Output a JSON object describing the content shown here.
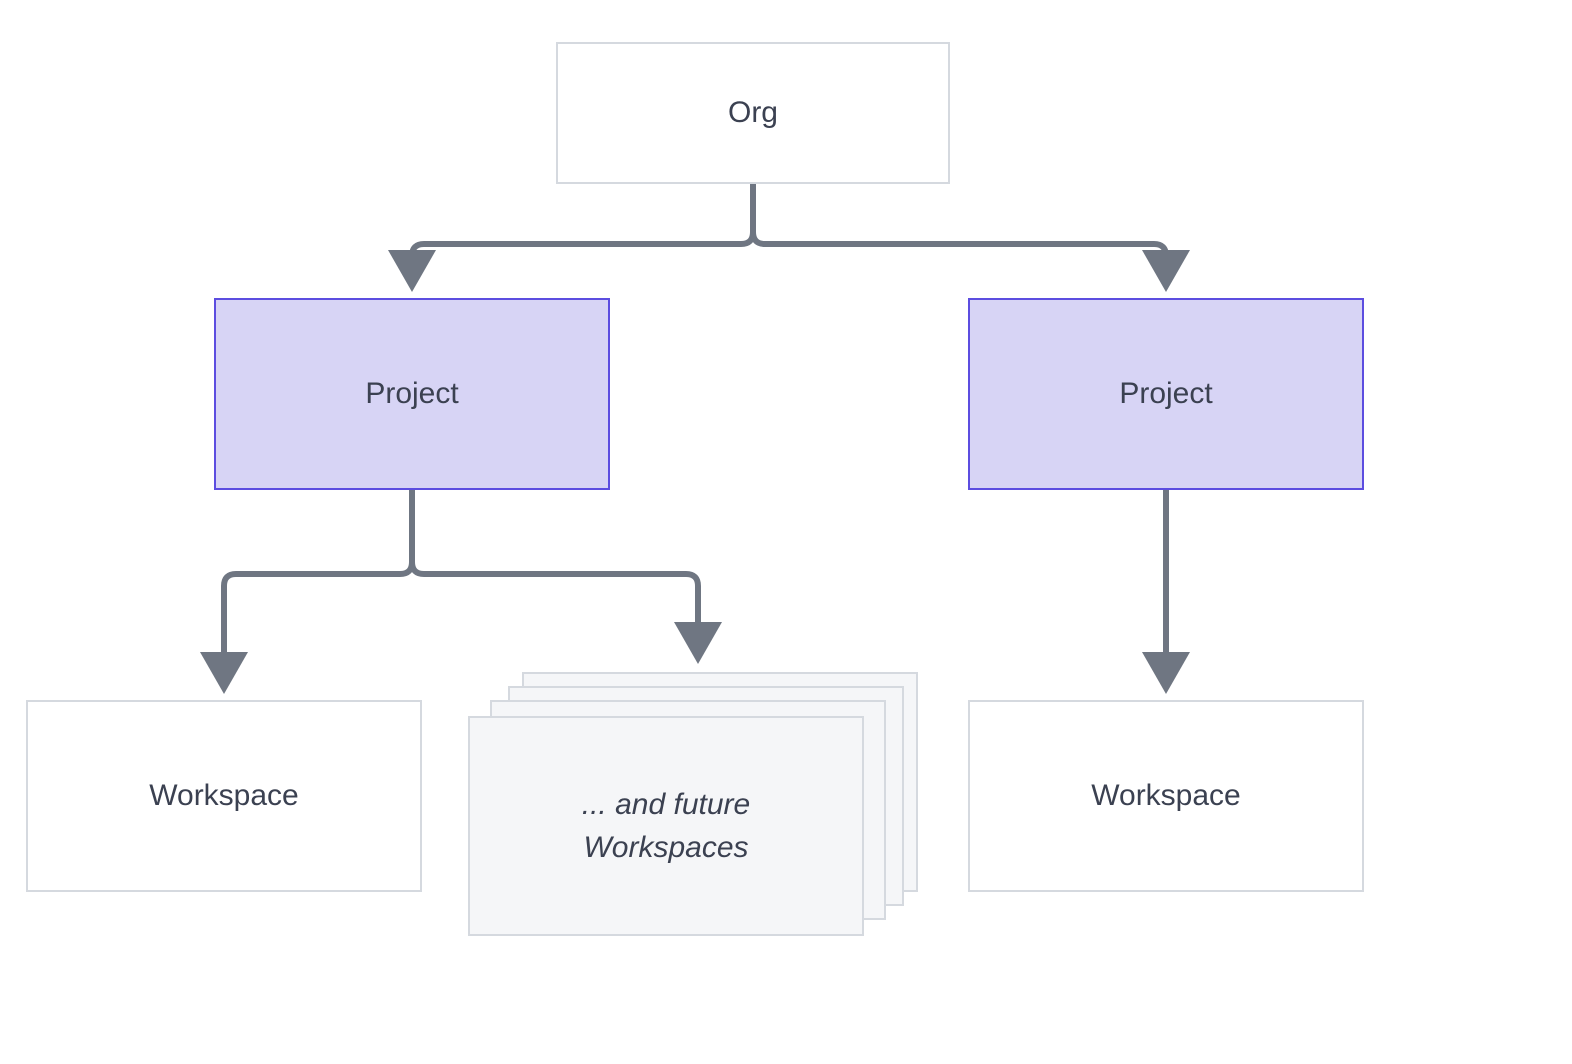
{
  "nodes": {
    "org": {
      "label": "Org"
    },
    "project_left": {
      "label": "Project"
    },
    "project_right": {
      "label": "Project"
    },
    "workspace_left": {
      "label": "Workspace"
    },
    "workspace_right": {
      "label": "Workspace"
    },
    "future_workspaces": {
      "label": "... and future Workspaces"
    }
  },
  "colors": {
    "box_border": "#d5d9df",
    "box_bg": "#ffffff",
    "project_bg": "#d7d4f5",
    "project_border": "#5c4de0",
    "stack_bg": "#f5f6f8",
    "arrow": "#6f7682",
    "text": "#3b4151"
  },
  "edges": [
    {
      "from": "org",
      "to": "project_left"
    },
    {
      "from": "org",
      "to": "project_right"
    },
    {
      "from": "project_left",
      "to": "workspace_left"
    },
    {
      "from": "project_left",
      "to": "future_workspaces"
    },
    {
      "from": "project_right",
      "to": "workspace_right"
    }
  ]
}
